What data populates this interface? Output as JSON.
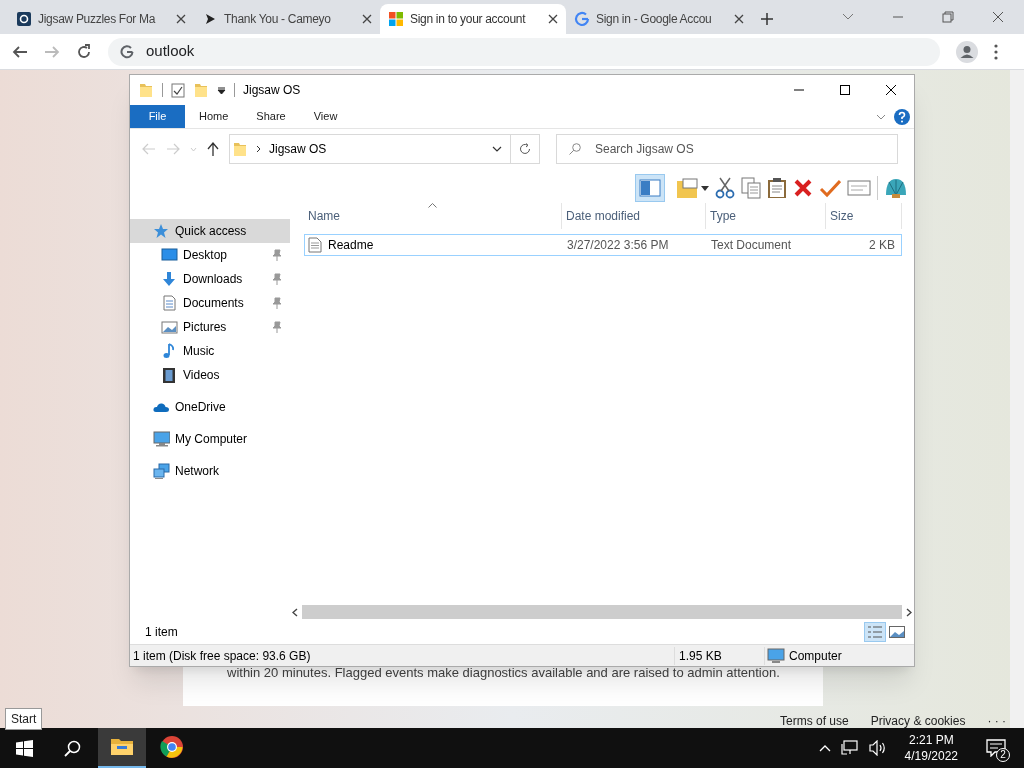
{
  "browser": {
    "tabs": [
      {
        "title": "Jigsaw Puzzles For Ma",
        "selected": false
      },
      {
        "title": "Thank You - Cameyo",
        "selected": false
      },
      {
        "title": "Sign in to your account",
        "selected": true
      },
      {
        "title": "Sign in - Google Accou",
        "selected": false
      }
    ],
    "address": "outlook"
  },
  "web_page": {
    "text": "within 20 minutes. Flagged events make diagnostics available and are raised to admin attention.",
    "footer_links": [
      "Terms of use",
      "Privacy & cookies",
      "· · ·"
    ]
  },
  "explorer": {
    "title": "Jigsaw OS",
    "ribbon_tabs": [
      {
        "label": "File",
        "kind": "file"
      },
      {
        "label": "Home",
        "kind": "tab"
      },
      {
        "label": "Share",
        "kind": "tab"
      },
      {
        "label": "View",
        "kind": "tab"
      }
    ],
    "path": "Jigsaw OS",
    "search": {
      "placeholder": "Search Jigsaw OS"
    },
    "nav": [
      {
        "label": "Quick access",
        "selected": true,
        "children": [
          {
            "label": "Desktop",
            "pinned": true,
            "selected": false
          },
          {
            "label": "Downloads",
            "pinned": true,
            "selected": false
          },
          {
            "label": "Documents",
            "pinned": true,
            "selected": false
          },
          {
            "label": "Pictures",
            "pinned": true,
            "selected": false
          },
          {
            "label": "Music",
            "pinned": false,
            "selected": false
          },
          {
            "label": "Videos",
            "pinned": false,
            "selected": false
          }
        ]
      },
      {
        "label": "OneDrive",
        "selected": false
      },
      {
        "label": "My Computer",
        "selected": false
      },
      {
        "label": "Network",
        "selected": false
      }
    ],
    "columns": [
      "Name",
      "Date modified",
      "Type",
      "Size"
    ],
    "rows": [
      {
        "name": "Readme",
        "date_modified": "3/27/2022 3:56 PM",
        "type": "Text Document",
        "size": "2 KB",
        "selected": false
      }
    ],
    "item_count": "1 item",
    "status_bar": {
      "summary": "1 item (Disk free space: 93.6 GB)",
      "size": "1.95 KB",
      "location": "Computer"
    }
  },
  "tooltip": "Start",
  "taskbar": {
    "apps": [
      {
        "active": true
      },
      {
        "active": false
      }
    ],
    "time": "2:21 PM",
    "date": "4/19/2022",
    "notifications": "2"
  }
}
